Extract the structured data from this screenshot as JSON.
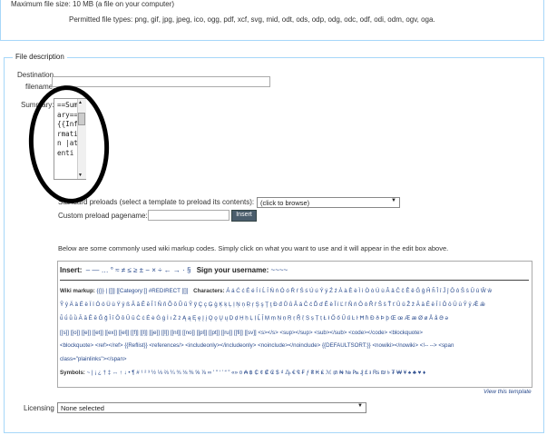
{
  "top": {
    "max_size": "Maximum file size: 10 MB (a file on your computer)",
    "permitted": "Permitted file types: png, gif, jpg, jpeg, ico, ogg, pdf, xcf, svg, mid, odt, ods, odp, odg, odc, odf, odi, odm, ogv, oga."
  },
  "fieldset": {
    "legend": "File description",
    "destination_label": "Destination",
    "filename_label": "filename:",
    "summary_label": "Summary:",
    "summary_text": "==Summary== {{Information |attenti",
    "preloads_label": "Standard preloads (select a template to preload its contents):",
    "preloads_value": "(click to browse)",
    "custom_label": "Custom preload pagename:",
    "insert_button": "Insert",
    "markup_intro": "Below are some commonly used wiki markup codes. Simply click on what you want to use and it will appear in the edit box above.",
    "insert_label": "Insert:",
    "insert_chars": "– — … ° ≈ ≠ ≤ ≥ ± − × ÷ ← → · §",
    "sign_label": "Sign your username:",
    "sign_value": "~~~~",
    "wiki_markup_label": "Wiki markup:",
    "wiki_markup_items": "{{}}  |  [[]]  [[Category:]]  #REDIRECT [[]]",
    "characters_label": "Characters:",
    "chars_line1": "Á á Ć ć É é Í í Ĺ ĺ Ń ń Ó ó Ŕ ŕ Ś ś Ú ú Ý ý Ź ź  À à È è Ì ì Ò ò Ù ù  Â â Ĉ ĉ Ê ê Ĝ ĝ Ĥ ĥ Î î Ĵ ĵ Ô ô Ŝ ŝ Û û Ŵ ŵ",
    "chars_line2": "Ŷ ŷ  Ä ä Ë ë Ï ï Ö ö Ü ü Ÿ ÿ  ß  Ã ã Ẽ ẽ Ĩ ĩ Ñ ñ Õ õ Ũ ũ Ỹ ỹ  Ç ç Ģ ģ Ķ ķ Ļ ļ Ņ ņ Ŗ ŗ Ş ş Ţ ţ  Đ đ  Ů ů  Ǎ ǎ Č č Ď ď Ě ě Ǐ ǐ Ľ ľ Ň ň Ǒ ǒ Ř ř Š š Ť ť Ǔ ǔ Ž ž  Ā ā Ē ē Ī ī Ō ō Ū ū Ȳ ȳ Ǣ ǣ",
    "chars_line3": "ǖ ǘ ǚ ǜ  Ă ă Ĕ ĕ Ğ ğ Ĭ ĭ Ŏ ŏ Ŭ ŭ  Ċ ċ Ė ė Ġ ġ İ ı Ż ż  Ą ą Ę ę Į į Ǫ ǫ Ų ų  Ḍ ḍ Ḥ ḥ Ḷ ḷ Ḹ ḹ Ṃ ṃ Ṇ ṇ Ṛ ṛ Ṝ ṝ Ṣ ṣ Ṭ ṭ  Ł ł  Ő ő Ű ű  Ŀ ŀ  Ħ ħ  Ð ð Þ þ  Œ œ  Æ æ Ø ø Å å  Ə ə",
    "tags_line1": "[[s]]  [[o]]  [[e]]  [[et]]  [[ex]]  [[el]]  [[f]]  [[l]]  [[je]]  [[l]]  [[nl]]  [[no]]  [[pl]]  [[pt]]  [[ru]]  [[fi]]  [[sv]]   <s></s>   <sup></sup>   <sub></sub>   <code></code>   <blockquote>",
    "tags_line2": "<blockquote>   <ref></ref>   {{Reflist}}   <references/>   <includeonly></includeonly>   <noinclude></noinclude>   {{DEFAULTSORT:}}   <nowiki></nowiki>   <!-- -->   <span",
    "tags_line3": "class=\"plainlinks\"></span>",
    "symbols_label": "Symbols:",
    "symbols_value": "~ | ¡ ¿ † ‡ ↔ ↑ ↓ • ¶  # ¹ ² ³ ½ ⅓ ⅔ ¼ ¾ ⅛ ⅜ ⅝ ⅞ ∞  ' \" ‘ ’ “ ” «»  ¤ ₳ ฿ ₵ ¢ ₡ ₢ $ ₫ ₯ € ₠ ₣ ƒ ₴ ₭ ₤ ℳ ₥ ₦ № ₧ ₰ £ ៛ ₨ ₪ ৳ ₮ ₩ ¥  ♠ ♣ ♥ ♦",
    "view_template": "View this template",
    "licensing_label": "Licensing",
    "licensing_value": "None selected"
  }
}
